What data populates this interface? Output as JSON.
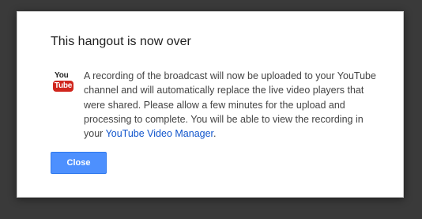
{
  "dialog": {
    "title": "This hangout is now over",
    "logo": {
      "icon": "youtube-logo",
      "top_text": "You",
      "bottom_text": "Tube"
    },
    "message_text": "A recording of the broadcast will now be uploaded to your YouTube channel and will automatically replace the live video players that were shared. Please allow a few minutes for the upload and processing to complete. You will be able to view the recording in your ",
    "message_link": "YouTube Video Manager",
    "message_end": ".",
    "close_label": "Close"
  },
  "colors": {
    "backdrop": "#3a3a3a",
    "button": "#4d90fe",
    "link": "#1155cc",
    "logo_red": "#d0261d"
  }
}
